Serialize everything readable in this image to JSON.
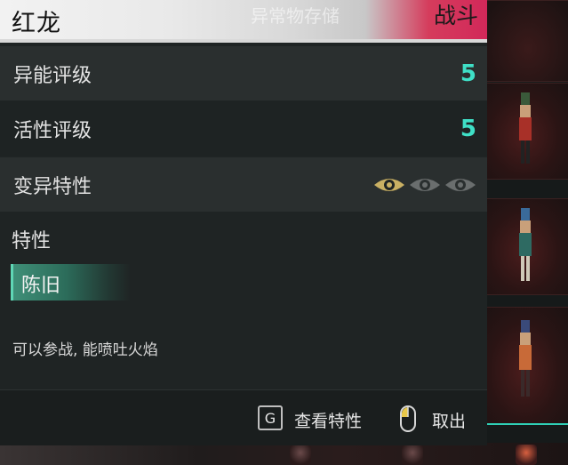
{
  "header": {
    "title": "红龙",
    "ghost_text": "异常物存储",
    "tag": "战斗"
  },
  "stats": [
    {
      "label": "异能评级",
      "value": "5"
    },
    {
      "label": "活性评级",
      "value": "5"
    },
    {
      "label": "变异特性",
      "eyes_total": 3,
      "eyes_active": 1
    }
  ],
  "traits": {
    "title": "特性",
    "items": [
      "陈旧"
    ]
  },
  "description": "可以参战, 能喷吐火焰",
  "footer": {
    "view_key": "G",
    "view_label": "查看特性",
    "exit_label": "取出"
  },
  "colors": {
    "accent": "#3fe0c7",
    "tag_red": "#d2285a",
    "eye_active": "#c9b063",
    "eye_inactive": "#6a6e6e"
  }
}
